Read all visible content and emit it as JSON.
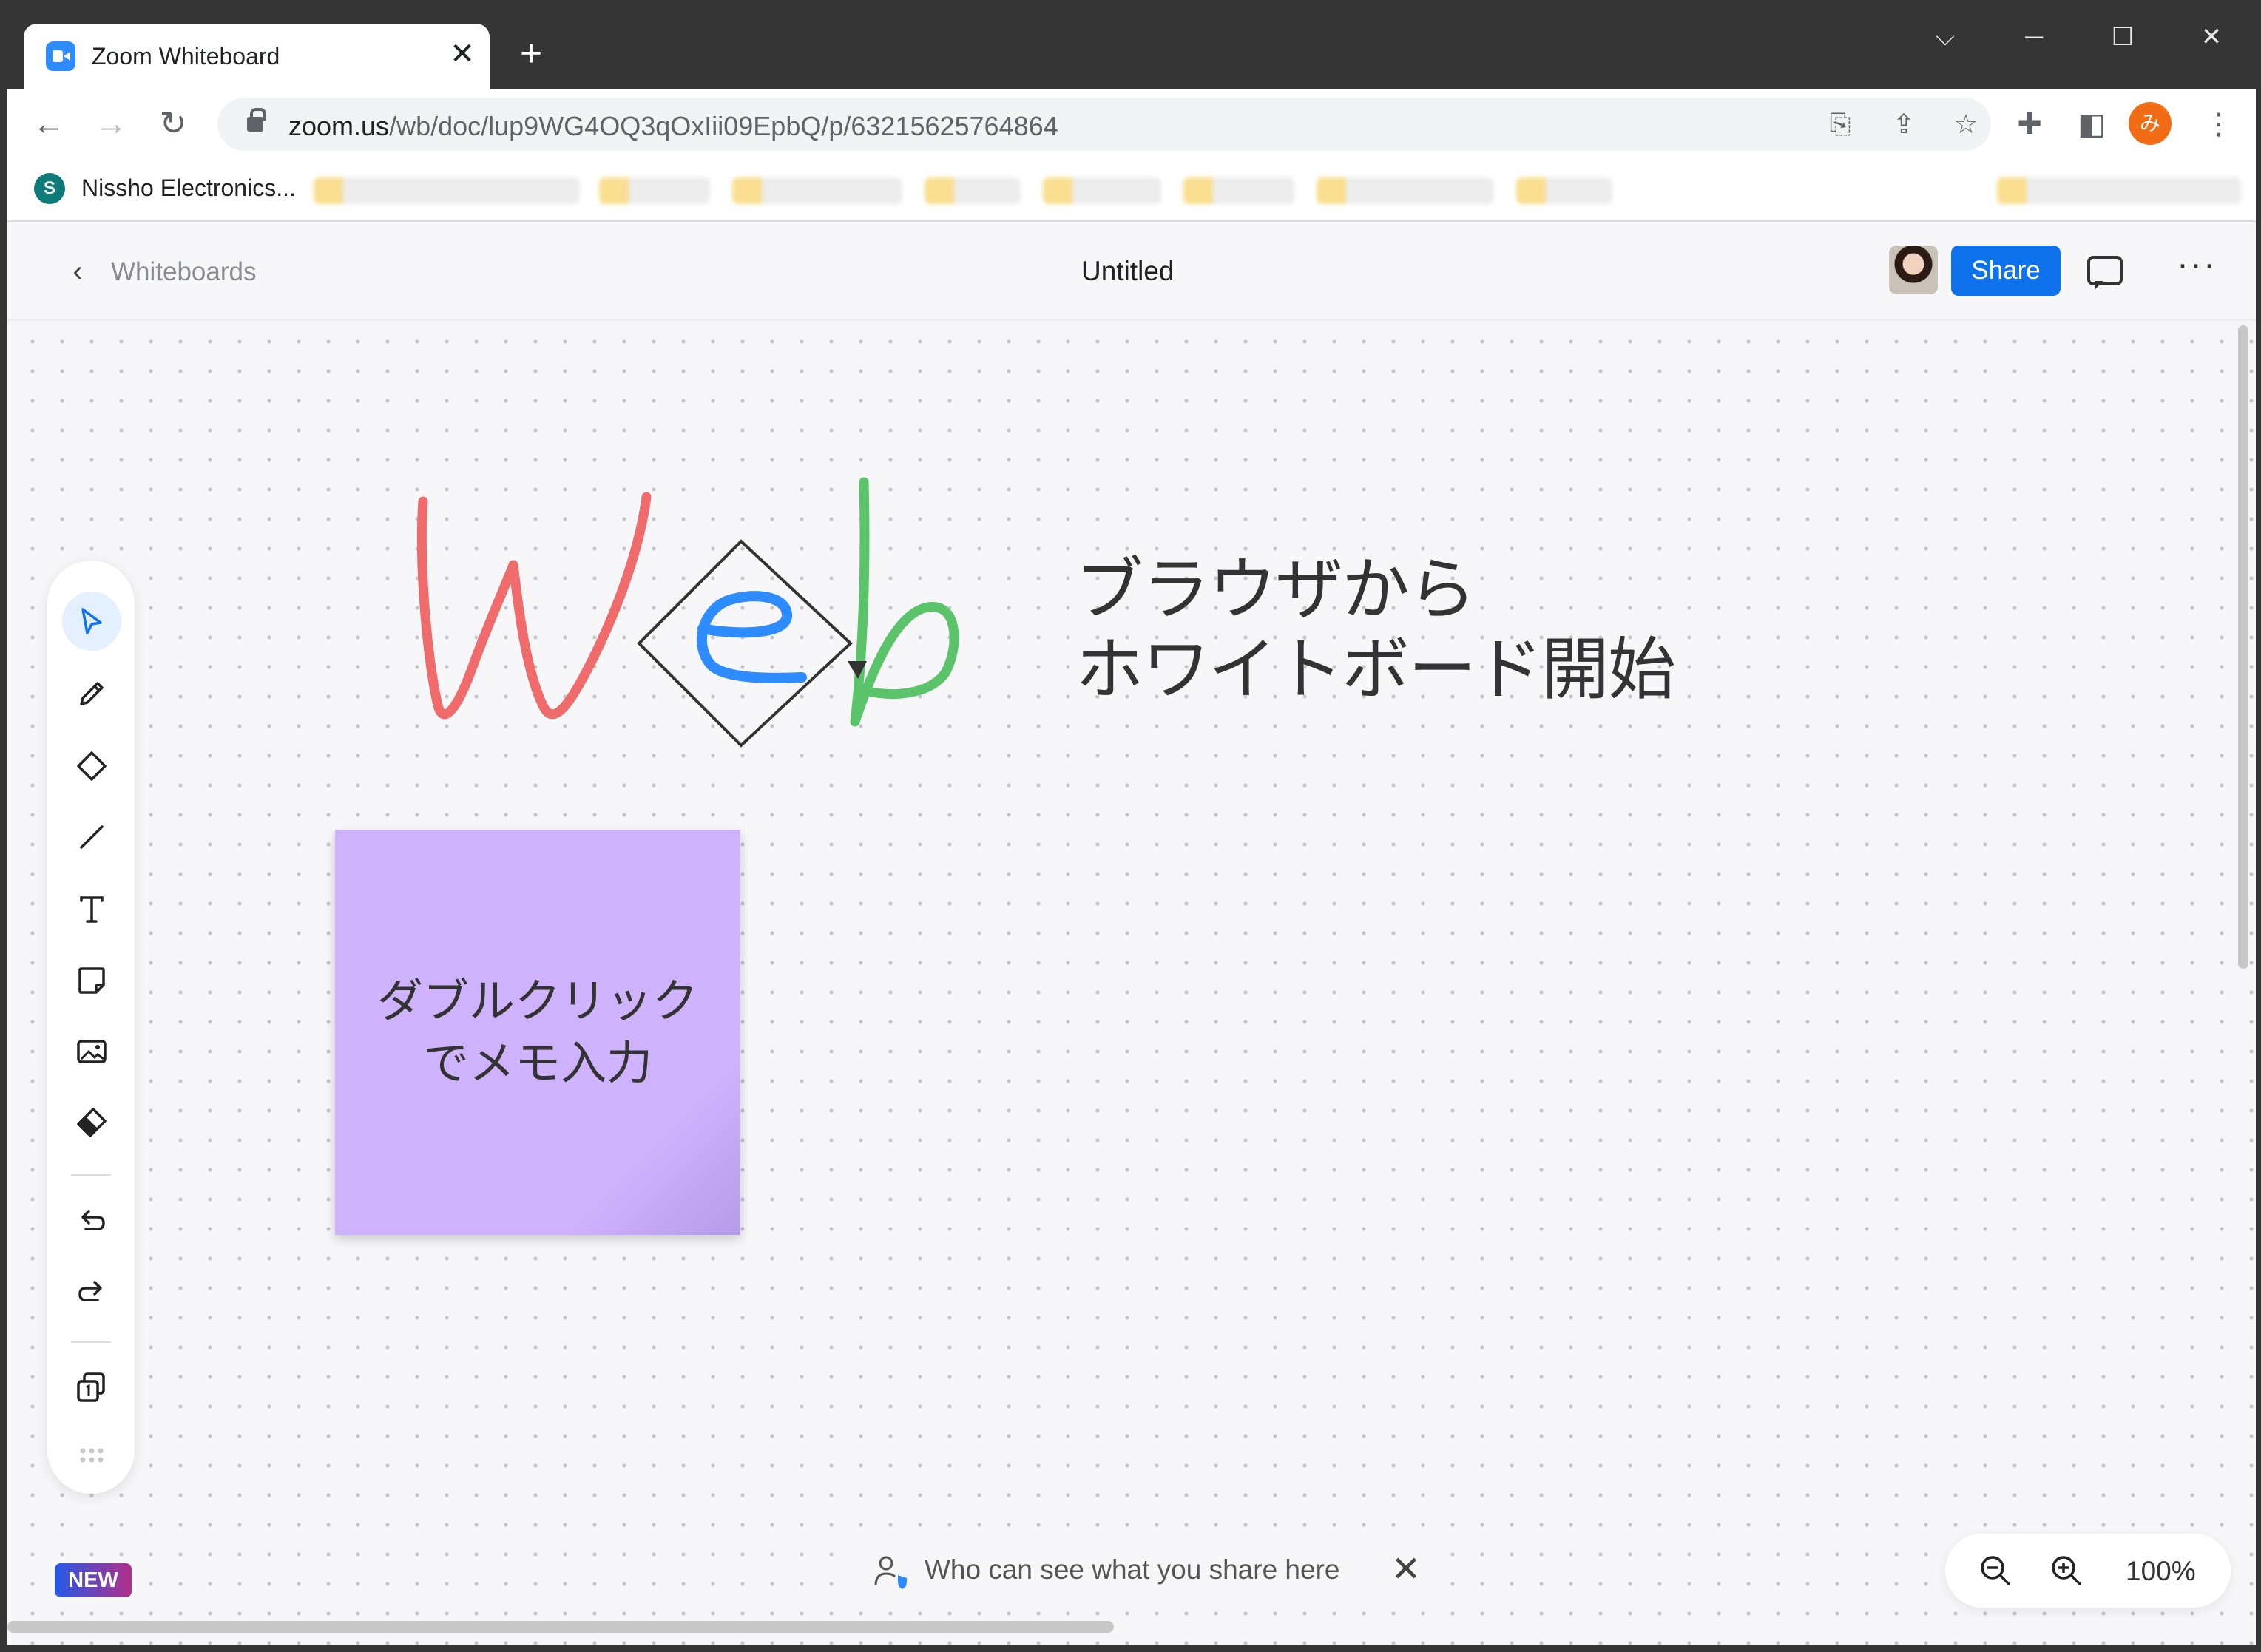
{
  "browser": {
    "tab_title": "Zoom Whiteboard",
    "tab_close": "✕",
    "new_tab": "+",
    "url_host": "zoom.us",
    "url_path": "/wb/doc/lup9WG4OQ3qOxIii09EpbQ/p/63215625764864",
    "profile_initial": "み",
    "bookmark_label": "Nissho Electronics...",
    "bookmark_icon_letter": "S"
  },
  "header": {
    "back_label": "Whiteboards",
    "doc_title": "Untitled",
    "share_label": "Share"
  },
  "canvas": {
    "heading_line1": "ブラウザから",
    "heading_line2": "ホワイトボード開始",
    "sticky_line1": "ダブルクリック",
    "sticky_line2": "でメモ入力",
    "sticky_color": "#cfb2fc",
    "stroke_colors": {
      "w": "#f06b6b",
      "e": "#2d8cff",
      "b": "#5bc46b",
      "shape": "#333333"
    }
  },
  "badges": {
    "new": "NEW"
  },
  "visibility_notice": "Who can see what you share here",
  "zoom": {
    "level": "100%"
  },
  "icons": {
    "tools": [
      "select-icon",
      "pen-icon",
      "shape-icon",
      "line-icon",
      "text-icon",
      "sticky-note-icon",
      "image-icon",
      "eraser-icon",
      "undo-icon",
      "redo-icon",
      "pages-icon",
      "more-tools-icon"
    ]
  },
  "colors": {
    "accent": "#0e72ed",
    "active_tool_bg": "#e4efff"
  }
}
